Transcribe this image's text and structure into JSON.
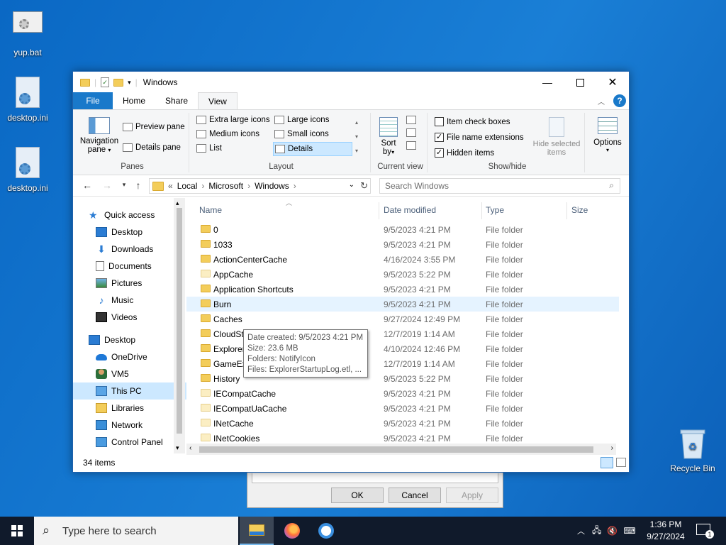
{
  "desktop": {
    "icons": [
      {
        "label": "yup.bat"
      },
      {
        "label": "desktop.ini"
      },
      {
        "label": "desktop.ini"
      },
      {
        "label": "Recycle Bin"
      }
    ]
  },
  "window": {
    "title": "Windows",
    "tabs": {
      "file": "File",
      "home": "Home",
      "share": "Share",
      "view": "View"
    },
    "ribbon": {
      "panes": {
        "navigation_pane": "Navigation",
        "navigation_pane_2": "pane",
        "preview_pane": "Preview pane",
        "details_pane": "Details pane",
        "label": "Panes"
      },
      "layout": {
        "extra_large_icons": "Extra large icons",
        "large_icons": "Large icons",
        "medium_icons": "Medium icons",
        "small_icons": "Small icons",
        "list": "List",
        "details": "Details",
        "label": "Layout"
      },
      "current_view": {
        "sort_by": "Sort",
        "sort_by_2": "by",
        "label": "Current view"
      },
      "show_hide": {
        "item_check_boxes": "Item check boxes",
        "file_name_extensions": "File name extensions",
        "hidden_items": "Hidden items",
        "hide_selected": "Hide selected",
        "hide_selected_2": "items",
        "label": "Show/hide"
      },
      "options": "Options"
    },
    "address": {
      "path": [
        "Local",
        "Microsoft",
        "Windows"
      ],
      "overflow": "«",
      "search_placeholder": "Search Windows"
    },
    "nav": {
      "quick_access": "Quick access",
      "qa_items": [
        "Desktop",
        "Downloads",
        "Documents",
        "Pictures",
        "Music",
        "Videos"
      ],
      "desktop": "Desktop",
      "tree_items": [
        "OneDrive",
        "VM5",
        "This PC",
        "Libraries",
        "Network",
        "Control Panel"
      ]
    },
    "columns": {
      "name": "Name",
      "date": "Date modified",
      "type": "Type",
      "size": "Size"
    },
    "files": [
      {
        "name": "0",
        "date": "9/5/2023 4:21 PM",
        "type": "File folder"
      },
      {
        "name": "1033",
        "date": "9/5/2023 4:21 PM",
        "type": "File folder"
      },
      {
        "name": "ActionCenterCache",
        "date": "4/16/2024 3:55 PM",
        "type": "File folder"
      },
      {
        "name": "AppCache",
        "date": "9/5/2023 5:22 PM",
        "type": "File folder"
      },
      {
        "name": "Application Shortcuts",
        "date": "9/5/2023 4:21 PM",
        "type": "File folder"
      },
      {
        "name": "Burn",
        "date": "9/5/2023 4:21 PM",
        "type": "File folder"
      },
      {
        "name": "Caches",
        "date": "9/27/2024 12:49 PM",
        "type": "File folder"
      },
      {
        "name": "CloudStore",
        "date": "12/7/2019 1:14 AM",
        "type": "File folder"
      },
      {
        "name": "Explorer",
        "date": "4/10/2024 12:46 PM",
        "type": "File folder"
      },
      {
        "name": "GameExplorer",
        "date": "12/7/2019 1:14 AM",
        "type": "File folder"
      },
      {
        "name": "History",
        "date": "9/5/2023 5:22 PM",
        "type": "File folder"
      },
      {
        "name": "IECompatCache",
        "date": "9/5/2023 4:21 PM",
        "type": "File folder"
      },
      {
        "name": "IECompatUaCache",
        "date": "9/5/2023 4:21 PM",
        "type": "File folder"
      },
      {
        "name": "INetCache",
        "date": "9/5/2023 4:21 PM",
        "type": "File folder"
      },
      {
        "name": "INetCookies",
        "date": "9/5/2023 4:21 PM",
        "type": "File folder"
      }
    ],
    "tooltip": {
      "line1": "Date created: 9/5/2023 4:21 PM",
      "line2": "Size: 23.6 MB",
      "line3": "Folders: NotifyIcon",
      "line4": "Files: ExplorerStartupLog.etl, ..."
    },
    "status": "34 items"
  },
  "dialog": {
    "ok": "OK",
    "cancel": "Cancel",
    "apply": "Apply"
  },
  "taskbar": {
    "search_placeholder": "Type here to search",
    "time": "1:36 PM",
    "date": "9/27/2024",
    "notification_count": "1"
  },
  "colors": {
    "accent": "#1979ca",
    "selection": "#cce8ff",
    "folder": "#f3cd5a"
  }
}
